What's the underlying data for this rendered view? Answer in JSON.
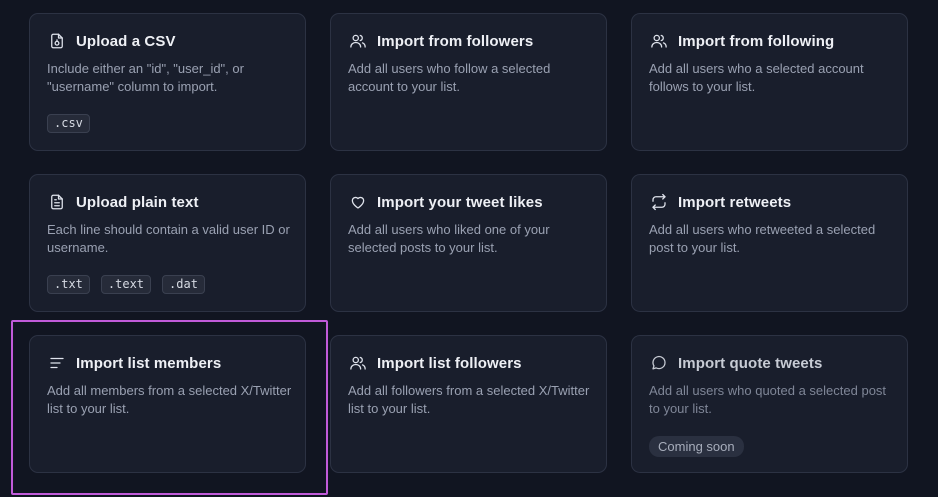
{
  "cards": [
    {
      "title": "Upload a CSV",
      "description": "Include either an \"id\", \"user_id\", or \"username\" column to import.",
      "icon": "file-upload-icon",
      "tags": [
        ".csv"
      ]
    },
    {
      "title": "Import from followers",
      "description": "Add all users who follow a selected account to your list.",
      "icon": "users-icon"
    },
    {
      "title": "Import from following",
      "description": "Add all users who a selected account follows to your list.",
      "icon": "users-icon"
    },
    {
      "title": "Upload plain text",
      "description": "Each line should contain a valid user ID or username.",
      "icon": "file-text-icon",
      "tags": [
        ".txt",
        ".text",
        ".dat"
      ]
    },
    {
      "title": "Import your tweet likes",
      "description": "Add all users who liked one of your selected posts to your list.",
      "icon": "heart-icon"
    },
    {
      "title": "Import retweets",
      "description": "Add all users who retweeted a selected post to your list.",
      "icon": "retweet-icon"
    },
    {
      "title": "Import list members",
      "description": "Add all members from a selected X/Twitter list to your list.",
      "icon": "list-icon"
    },
    {
      "title": "Import list followers",
      "description": "Add all followers from a selected X/Twitter list to your list.",
      "icon": "users-icon"
    },
    {
      "title": "Import quote tweets",
      "description": "Add all users who quoted a selected post to your list.",
      "icon": "message-circle-icon",
      "badge": "Coming soon"
    }
  ],
  "colors": {
    "background": "#111521",
    "card": "#191e2c",
    "highlight": "#c15bd9"
  }
}
